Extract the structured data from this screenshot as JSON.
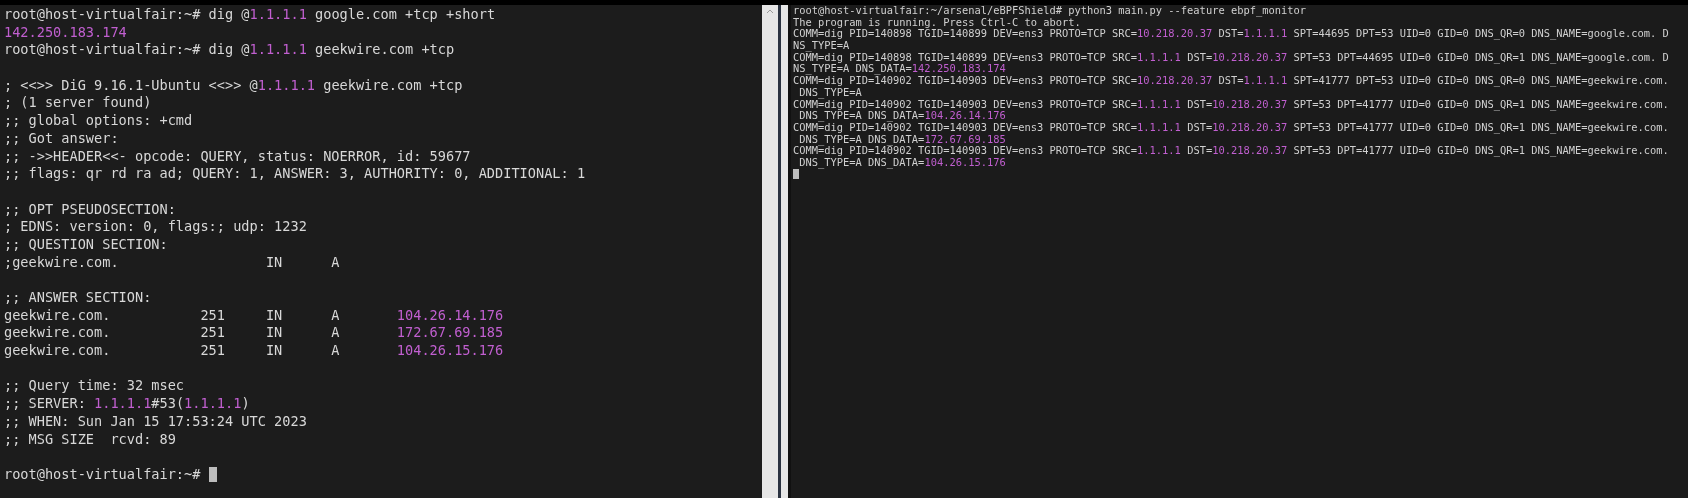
{
  "left_terminal": {
    "blocks": [
      {
        "lines": [
          [
            {
              "text": "root@host-virtualfair:~# dig @",
              "highlight": false
            },
            {
              "text": "1.1.1.1",
              "highlight": true
            },
            {
              "text": " google.com +tcp +short",
              "highlight": false
            }
          ],
          [
            {
              "text": "142.250.183.174",
              "highlight": true
            }
          ],
          [
            {
              "text": "root@host-virtualfair:~# dig @",
              "highlight": false
            },
            {
              "text": "1.1.1.1",
              "highlight": true
            },
            {
              "text": " geekwire.com +tcp",
              "highlight": false
            }
          ]
        ]
      },
      {
        "lines": [
          [
            {
              "text": "; <<>> DiG 9.16.1-Ubuntu <<>> @",
              "highlight": false
            },
            {
              "text": "1.1.1.1",
              "highlight": true
            },
            {
              "text": " geekwire.com +tcp",
              "highlight": false
            }
          ],
          [
            {
              "text": "; (1 server found)",
              "highlight": false
            }
          ],
          [
            {
              "text": ";; global options: +cmd",
              "highlight": false
            }
          ],
          [
            {
              "text": ";; Got answer:",
              "highlight": false
            }
          ],
          [
            {
              "text": ";; ->>HEADER<<- opcode: QUERY, status: NOERROR, id: 59677",
              "highlight": false
            }
          ],
          [
            {
              "text": ";; flags: qr rd ra ad; QUERY: 1, ANSWER: 3, AUTHORITY: 0, ADDITIONAL: 1",
              "highlight": false
            }
          ]
        ]
      },
      {
        "lines": [
          [
            {
              "text": ";; OPT PSEUDOSECTION:",
              "highlight": false
            }
          ],
          [
            {
              "text": "; EDNS: version: 0, flags:; udp: 1232",
              "highlight": false
            }
          ],
          [
            {
              "text": ";; QUESTION SECTION:",
              "highlight": false
            }
          ],
          [
            {
              "text": ";geekwire.com.                  IN      A",
              "highlight": false
            }
          ]
        ]
      },
      {
        "lines": [
          [
            {
              "text": ";; ANSWER SECTION:",
              "highlight": false
            }
          ],
          [
            {
              "text": "geekwire.com.           251     IN      A       ",
              "highlight": false
            },
            {
              "text": "104.26.14.176",
              "highlight": true
            }
          ],
          [
            {
              "text": "geekwire.com.           251     IN      A       ",
              "highlight": false
            },
            {
              "text": "172.67.69.185",
              "highlight": true
            }
          ],
          [
            {
              "text": "geekwire.com.           251     IN      A       ",
              "highlight": false
            },
            {
              "text": "104.26.15.176",
              "highlight": true
            }
          ]
        ]
      },
      {
        "lines": [
          [
            {
              "text": ";; Query time: 32 msec",
              "highlight": false
            }
          ],
          [
            {
              "text": ";; SERVER: ",
              "highlight": false
            },
            {
              "text": "1.1.1.1",
              "highlight": true
            },
            {
              "text": "#53(",
              "highlight": false
            },
            {
              "text": "1.1.1.1",
              "highlight": true
            },
            {
              "text": ")",
              "highlight": false
            }
          ],
          [
            {
              "text": ";; WHEN: Sun Jan 15 17:53:24 UTC 2023",
              "highlight": false
            }
          ],
          [
            {
              "text": ";; MSG SIZE  rcvd: 89",
              "highlight": false
            }
          ]
        ]
      },
      {
        "lines": [
          [
            {
              "text": "root@host-virtualfair:~# ",
              "highlight": false
            }
          ]
        ]
      }
    ]
  },
  "right_terminal": {
    "lines": [
      [
        {
          "text": "root@host-virtualfair:~/arsenal/eBPFShield# python3 main.py --feature ebpf_monitor",
          "highlight": false
        }
      ],
      [
        {
          "text": "The program is running. Press Ctrl-C to abort.",
          "highlight": false
        }
      ],
      [
        {
          "text": "COMM=dig PID=140898 TGID=140899 DEV=ens3 PROTO=TCP SRC=",
          "highlight": false
        },
        {
          "text": "10.218.20.37",
          "highlight": true
        },
        {
          "text": " DST=",
          "highlight": false
        },
        {
          "text": "1.1.1.1",
          "highlight": true
        },
        {
          "text": " SPT=44695 DPT=53 UID=0 GID=0 DNS_QR=0 DNS_NAME=google.com. D",
          "highlight": false
        }
      ],
      [
        {
          "text": "NS_TYPE=A",
          "highlight": false
        }
      ],
      [
        {
          "text": "COMM=dig PID=140898 TGID=140899 DEV=ens3 PROTO=TCP SRC=",
          "highlight": false
        },
        {
          "text": "1.1.1.1",
          "highlight": true
        },
        {
          "text": " DST=",
          "highlight": false
        },
        {
          "text": "10.218.20.37",
          "highlight": true
        },
        {
          "text": " SPT=53 DPT=44695 UID=0 GID=0 DNS_QR=1 DNS_NAME=google.com. D",
          "highlight": false
        }
      ],
      [
        {
          "text": "NS_TYPE=A DNS_DATA=",
          "highlight": false
        },
        {
          "text": "142.250.183.174",
          "highlight": true
        }
      ],
      [
        {
          "text": "COMM=dig PID=140902 TGID=140903 DEV=ens3 PROTO=TCP SRC=",
          "highlight": false
        },
        {
          "text": "10.218.20.37",
          "highlight": true
        },
        {
          "text": " DST=",
          "highlight": false
        },
        {
          "text": "1.1.1.1",
          "highlight": true
        },
        {
          "text": " SPT=41777 DPT=53 UID=0 GID=0 DNS_QR=0 DNS_NAME=geekwire.com.",
          "highlight": false
        }
      ],
      [
        {
          "text": " DNS_TYPE=A",
          "highlight": false
        }
      ],
      [
        {
          "text": "COMM=dig PID=140902 TGID=140903 DEV=ens3 PROTO=TCP SRC=",
          "highlight": false
        },
        {
          "text": "1.1.1.1",
          "highlight": true
        },
        {
          "text": " DST=",
          "highlight": false
        },
        {
          "text": "10.218.20.37",
          "highlight": true
        },
        {
          "text": " SPT=53 DPT=41777 UID=0 GID=0 DNS_QR=1 DNS_NAME=geekwire.com.",
          "highlight": false
        }
      ],
      [
        {
          "text": " DNS_TYPE=A DNS_DATA=",
          "highlight": false
        },
        {
          "text": "104.26.14.176",
          "highlight": true
        }
      ],
      [
        {
          "text": "COMM=dig PID=140902 TGID=140903 DEV=ens3 PROTO=TCP SRC=",
          "highlight": false
        },
        {
          "text": "1.1.1.1",
          "highlight": true
        },
        {
          "text": " DST=",
          "highlight": false
        },
        {
          "text": "10.218.20.37",
          "highlight": true
        },
        {
          "text": " SPT=53 DPT=41777 UID=0 GID=0 DNS_QR=1 DNS_NAME=geekwire.com.",
          "highlight": false
        }
      ],
      [
        {
          "text": " DNS_TYPE=A DNS_DATA=",
          "highlight": false
        },
        {
          "text": "172.67.69.185",
          "highlight": true
        }
      ],
      [
        {
          "text": "COMM=dig PID=140902 TGID=140903 DEV=ens3 PROTO=TCP SRC=",
          "highlight": false
        },
        {
          "text": "1.1.1.1",
          "highlight": true
        },
        {
          "text": " DST=",
          "highlight": false
        },
        {
          "text": "10.218.20.37",
          "highlight": true
        },
        {
          "text": " SPT=53 DPT=41777 UID=0 GID=0 DNS_QR=1 DNS_NAME=geekwire.com.",
          "highlight": false
        }
      ],
      [
        {
          "text": " DNS_TYPE=A DNS_DATA=",
          "highlight": false
        },
        {
          "text": "104.26.15.176",
          "highlight": true
        }
      ]
    ]
  }
}
